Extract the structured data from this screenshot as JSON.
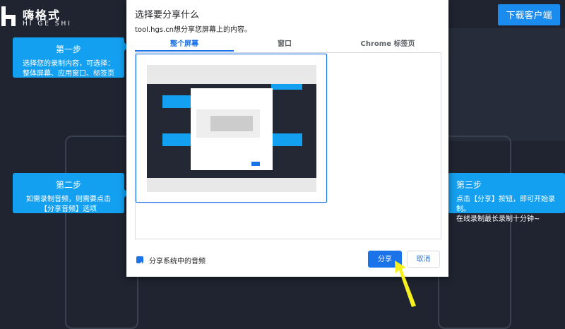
{
  "logo": {
    "cn": "嗨格式",
    "en": "HI GE SHI"
  },
  "header": {
    "download_label": "下载客户端"
  },
  "steps": [
    {
      "title": "第一步",
      "lines": [
        "选择您的录制内容，可选择：",
        "整体屏幕、应用窗口、标签页"
      ]
    },
    {
      "title": "第二步",
      "lines": [
        "如需录制音频，则需要点击",
        "【分享音频】选项"
      ]
    },
    {
      "title": "第三步",
      "lines": [
        "点击【分享】按钮，即可开始录制。",
        "在线录制最长录制十分钟~"
      ]
    }
  ],
  "dialog": {
    "title": "选择要分享什么",
    "subtitle": "tool.hgs.cn想分享您屏幕上的内容。",
    "tabs": [
      {
        "label": "整个屏幕"
      },
      {
        "label": "窗口"
      },
      {
        "label": "Chrome 标签页"
      }
    ],
    "audio_checkbox_label": "分享系统中的音频",
    "share_label": "分享",
    "cancel_label": "取消"
  },
  "colors": {
    "accent": "#1a73e8",
    "step_bg": "#14a0f0",
    "page_bg": "#1f2430",
    "pointer": "#f5f01e"
  }
}
